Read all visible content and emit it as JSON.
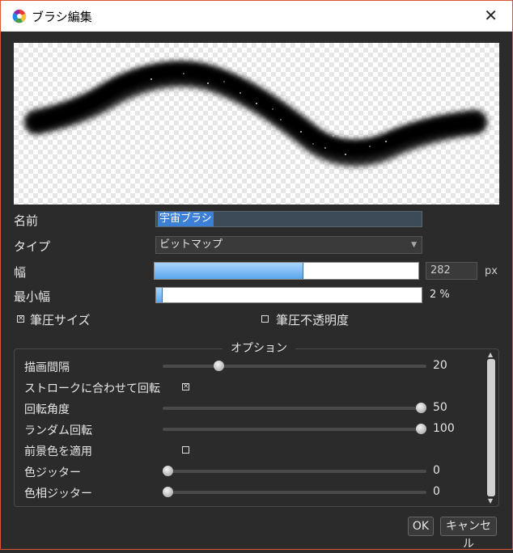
{
  "window": {
    "title": "ブラシ編集"
  },
  "form": {
    "name_label": "名前",
    "name_value": "宇宙ブラシ",
    "type_label": "タイプ",
    "type_value": "ビットマップ",
    "width_label": "幅",
    "width_value": "282",
    "width_unit": "px",
    "width_fill_fraction": 0.56,
    "min_width_label": "最小幅",
    "min_width_value": "2 %",
    "min_width_fill_fraction": 0.02,
    "pressure_size_label": "筆圧サイズ",
    "pressure_size_checked": true,
    "pressure_opacity_label": "筆圧不透明度",
    "pressure_opacity_checked": false
  },
  "options": {
    "title": "オプション",
    "rows": [
      {
        "label": "描画間隔",
        "kind": "slider",
        "value": "20",
        "fraction": 0.2
      },
      {
        "label": "ストロークに合わせて回転",
        "kind": "checkbox",
        "checked": true
      },
      {
        "label": "回転角度",
        "kind": "slider",
        "value": "50",
        "fraction": 1.0
      },
      {
        "label": "ランダム回転",
        "kind": "slider",
        "value": "100",
        "fraction": 1.0
      },
      {
        "label": "前景色を適用",
        "kind": "checkbox",
        "checked": false
      },
      {
        "label": "色ジッター",
        "kind": "slider",
        "value": "0",
        "fraction": 0.0
      },
      {
        "label": "色相ジッター",
        "kind": "slider",
        "value": "0",
        "fraction": 0.0
      }
    ]
  },
  "buttons": {
    "ok": "OK",
    "cancel": "キャンセル"
  },
  "icons": {
    "app": "color-wheel-icon",
    "close": "close-icon",
    "dropdown": "chevron-down-icon"
  },
  "colors": {
    "accent_fill": "#5aa7ec",
    "selection": "#3c7fd6",
    "window_border": "#e0553a"
  }
}
